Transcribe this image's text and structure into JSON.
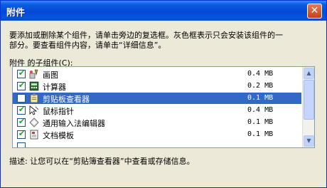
{
  "window": {
    "title": "附件"
  },
  "description": {
    "line1": "要添加或删除某个组件，请单击旁边的复选框。灰色框表示只会安装该组件的一",
    "line2": "部分。要查看组件内容，请单击“详细信息”。"
  },
  "list_label": "附件 的子组件(C):",
  "components": [
    {
      "name": "画图",
      "size": "0.4 MB",
      "checked": true,
      "icon": "paint-icon"
    },
    {
      "name": "计算器",
      "size": "0.2 MB",
      "checked": true,
      "icon": "calculator-icon"
    },
    {
      "name": "剪贴板查看器",
      "size": "0.1 MB",
      "checked": false,
      "selected": true,
      "icon": "clipboard-viewer-icon"
    },
    {
      "name": "鼠标指针",
      "size": "0.4 MB",
      "checked": true,
      "icon": "mouse-pointer-icon"
    },
    {
      "name": "通用输入法编辑器",
      "size": "0.1 MB",
      "checked": true,
      "icon": "ime-icon"
    },
    {
      "name": "文档模板",
      "size": "0.1 MB",
      "checked": true,
      "icon": "document-template-icon"
    }
  ],
  "detail_text": "描述:  让您可以在“剪贴簿查看器”中查看或存储信息。",
  "colors": {
    "title_bar": "#0549d6",
    "selection": "#316ac5",
    "check": "#21a121"
  }
}
